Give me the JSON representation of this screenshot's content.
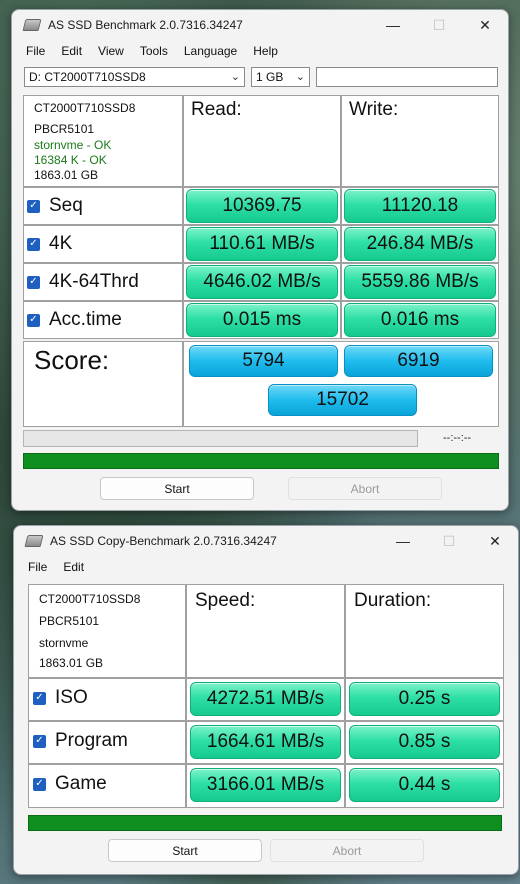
{
  "bench": {
    "title": "AS SSD Benchmark 2.0.7316.34247",
    "menu": [
      "File",
      "Edit",
      "View",
      "Tools",
      "Language",
      "Help"
    ],
    "drive_select": "D: CT2000T710SSD8",
    "size_select": "1 GB",
    "search_value": "",
    "drive_info": {
      "model": "CT2000T710SSD8",
      "firmware": "PBCR5101",
      "driver": "stornvme - OK",
      "alignment": "16384 K - OK",
      "capacity": "1863.01 GB"
    },
    "headers": {
      "read": "Read:",
      "write": "Write:"
    },
    "rows": [
      {
        "label": "Seq",
        "read": "10369.75",
        "write": "11120.18"
      },
      {
        "label": "4K",
        "read": "110.61 MB/s",
        "write": "246.84 MB/s"
      },
      {
        "label": "4K-64Thrd",
        "read": "4646.02 MB/s",
        "write": "5559.86 MB/s"
      },
      {
        "label": "Acc.time",
        "read": "0.015 ms",
        "write": "0.016 ms"
      }
    ],
    "score": {
      "label": "Score:",
      "read": "5794",
      "write": "6919",
      "total": "15702"
    },
    "time_display": "--:--:--",
    "progress_top": 0,
    "progress_bottom": 1.0,
    "start_label": "Start",
    "abort_label": "Abort"
  },
  "copy": {
    "title": "AS SSD Copy-Benchmark 2.0.7316.34247",
    "menu": [
      "File",
      "Edit"
    ],
    "drive_info": {
      "model": "CT2000T710SSD8",
      "firmware": "PBCR5101",
      "driver": "stornvme",
      "capacity": "1863.01 GB"
    },
    "headers": {
      "speed": "Speed:",
      "duration": "Duration:"
    },
    "rows": [
      {
        "label": "ISO",
        "speed": "4272.51 MB/s",
        "duration": "0.25 s"
      },
      {
        "label": "Program",
        "speed": "1664.61 MB/s",
        "duration": "0.85 s"
      },
      {
        "label": "Game",
        "speed": "3166.01 MB/s",
        "duration": "0.44 s"
      }
    ],
    "progress": 1.0,
    "start_label": "Start",
    "abort_label": "Abort"
  },
  "icons": {
    "minimize": "—",
    "maximize": "☐",
    "close": "✕",
    "checkbox": "✓",
    "dropdown": "⌄"
  }
}
